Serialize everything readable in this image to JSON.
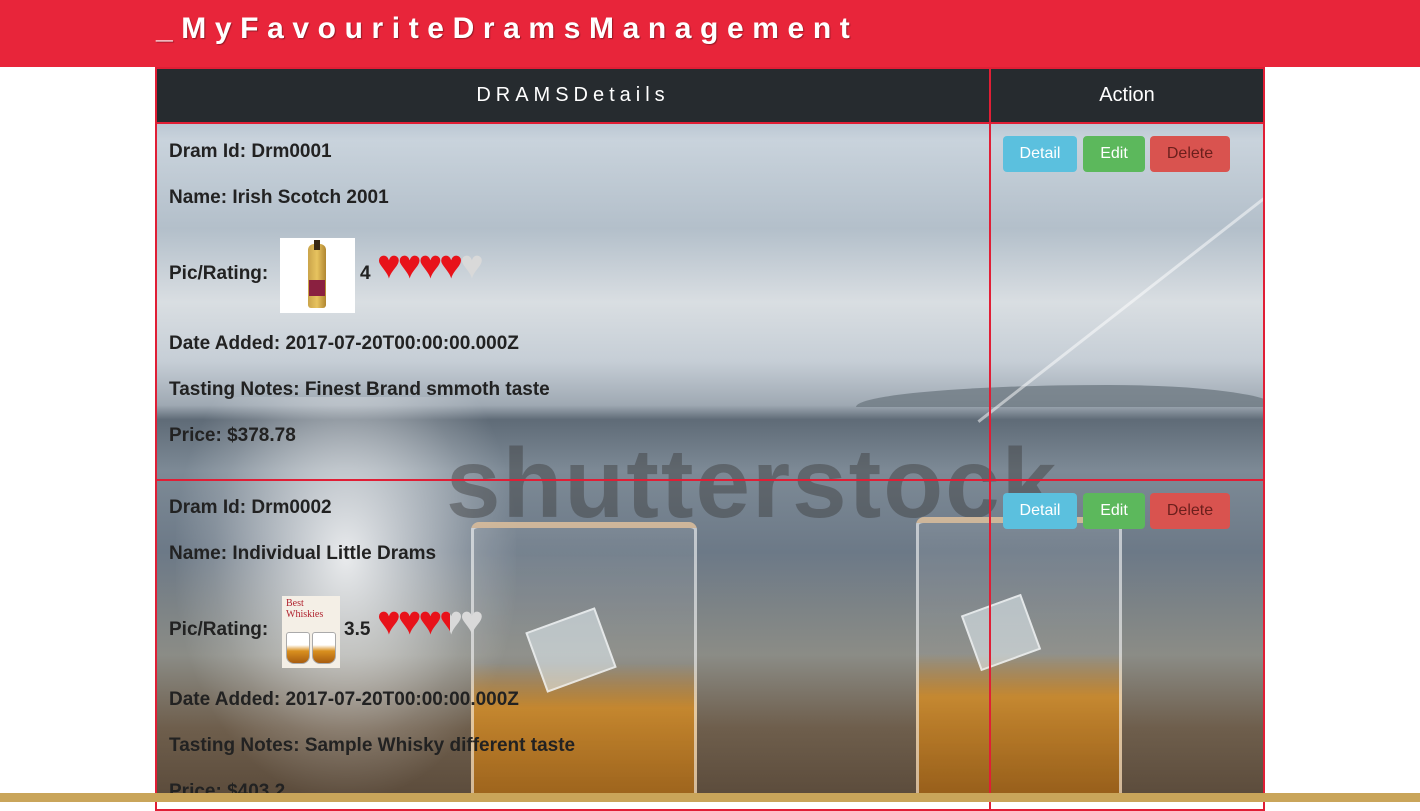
{
  "header": {
    "brand": "_MyFavouriteDramsManagement"
  },
  "table": {
    "col_details": "DRAMSDetails",
    "col_action": "Action"
  },
  "background": {
    "watermark": "shutterstock"
  },
  "drams": [
    {
      "id_label": "Dram Id: Drm0001",
      "name_label": "Name: Irish Scotch 2001",
      "pic_label": "Pic/Rating:",
      "rating": "4",
      "rating_value": 4,
      "date_label": "Date Added: 2017-07-20T00:00:00.000Z",
      "notes_label": "Tasting Notes: Finest Brand smmoth taste",
      "price_label": "Price: $378.78",
      "thumb_icon": "whisky-bottle-icon"
    },
    {
      "id_label": "Dram Id: Drm0002",
      "name_label": "Name: Individual Little Drams",
      "pic_label": "Pic/Rating:",
      "rating": "3.5",
      "rating_value": 3.5,
      "date_label": "Date Added: 2017-07-20T00:00:00.000Z",
      "notes_label": "Tasting Notes: Sample Whisky different taste",
      "price_label": "Price: $403.2",
      "thumb_icon": "whisky-book-icon",
      "thumb_text": "Best Whiskies"
    }
  ],
  "actions": {
    "detail": "Detail",
    "edit": "Edit",
    "delete": "Delete"
  },
  "colors": {
    "topbar": "#e8253a",
    "table_header": "#262b2f",
    "grid_lines": "#e01e35",
    "detail": "#5bc0de",
    "edit": "#5cb85c",
    "delete": "#d9534f",
    "heart": "#e8121a"
  }
}
